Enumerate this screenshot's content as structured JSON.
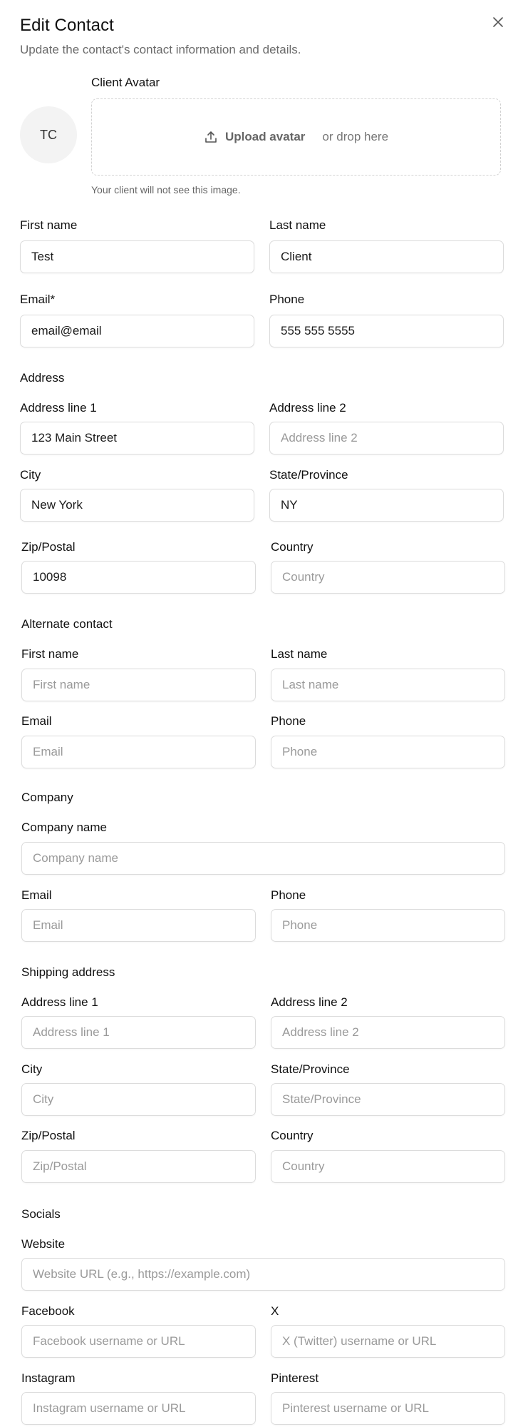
{
  "dialog": {
    "title": "Edit Contact",
    "subtitle": "Update the contact's contact information and details."
  },
  "avatar": {
    "initials": "TC",
    "label": "Client Avatar",
    "upload_label": "Upload avatar",
    "drop_label": "or drop here",
    "hint": "Your client will not see this image."
  },
  "contact": {
    "first_name": {
      "label": "First name",
      "value": "Test",
      "placeholder": ""
    },
    "last_name": {
      "label": "Last name",
      "value": "Client",
      "placeholder": ""
    },
    "email": {
      "label": "Email*",
      "value": "email@email",
      "placeholder": ""
    },
    "phone": {
      "label": "Phone",
      "value": "555 555 5555",
      "placeholder": ""
    }
  },
  "address": {
    "section": "Address",
    "line1": {
      "label": "Address line 1",
      "value": "123 Main Street",
      "placeholder": ""
    },
    "line2": {
      "label": "Address line 2",
      "value": "",
      "placeholder": "Address line 2"
    },
    "city": {
      "label": "City",
      "value": "New York",
      "placeholder": ""
    },
    "state": {
      "label": "State/Province",
      "value": "NY",
      "placeholder": ""
    },
    "zip": {
      "label": "Zip/Postal",
      "value": "10098",
      "placeholder": ""
    },
    "country": {
      "label": "Country",
      "value": "",
      "placeholder": "Country"
    }
  },
  "alternate": {
    "section": "Alternate contact",
    "first_name": {
      "label": "First name",
      "placeholder": "First name"
    },
    "last_name": {
      "label": "Last name",
      "placeholder": "Last name"
    },
    "email": {
      "label": "Email",
      "placeholder": "Email"
    },
    "phone": {
      "label": "Phone",
      "placeholder": "Phone"
    }
  },
  "company": {
    "section": "Company",
    "name": {
      "label": "Company name",
      "placeholder": "Company name"
    },
    "email": {
      "label": "Email",
      "placeholder": "Email"
    },
    "phone": {
      "label": "Phone",
      "placeholder": "Phone"
    }
  },
  "shipping": {
    "section": "Shipping address",
    "line1": {
      "label": "Address line 1",
      "placeholder": "Address line 1"
    },
    "line2": {
      "label": "Address line 2",
      "placeholder": "Address line 2"
    },
    "city": {
      "label": "City",
      "placeholder": "City"
    },
    "state": {
      "label": "State/Province",
      "placeholder": "State/Province"
    },
    "zip": {
      "label": "Zip/Postal",
      "placeholder": "Zip/Postal"
    },
    "country": {
      "label": "Country",
      "placeholder": "Country"
    }
  },
  "socials": {
    "section": "Socials",
    "website": {
      "label": "Website",
      "placeholder": "Website URL (e.g., https://example.com)"
    },
    "facebook": {
      "label": "Facebook",
      "placeholder": "Facebook username or URL"
    },
    "x": {
      "label": "X",
      "placeholder": "X (Twitter) username or URL"
    },
    "instagram": {
      "label": "Instagram",
      "placeholder": "Instagram username or URL"
    },
    "pinterest": {
      "label": "Pinterest",
      "placeholder": "Pinterest username or URL"
    }
  },
  "icons": {
    "close": "close-icon",
    "upload": "upload-icon"
  }
}
